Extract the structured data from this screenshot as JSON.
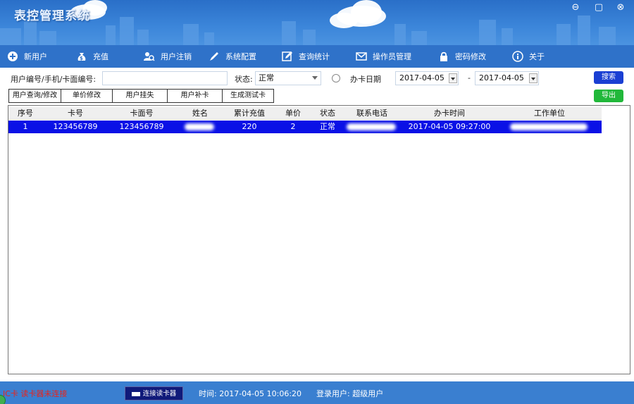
{
  "app": {
    "title": "表控管理系统"
  },
  "window_controls": {
    "minimize": "⊖",
    "maximize": "▢",
    "close": "⊗"
  },
  "toolbar": {
    "items": [
      {
        "label": "新用户",
        "icon": "plus-circle-icon"
      },
      {
        "label": "充值",
        "icon": "money-bag-icon"
      },
      {
        "label": "用户注销",
        "icon": "user-search-icon"
      },
      {
        "label": "系统配置",
        "icon": "pen-icon"
      },
      {
        "label": "查询统计",
        "icon": "edit-report-icon"
      },
      {
        "label": "操作员管理",
        "icon": "envelope-icon"
      },
      {
        "label": "密码修改",
        "icon": "lock-icon"
      },
      {
        "label": "关于",
        "icon": "info-icon"
      }
    ]
  },
  "filter": {
    "user_label": "用户编号/手机/卡面编号:",
    "user_value": "",
    "status_label": "状态:",
    "status_value": "正常",
    "date_label": "办卡日期",
    "date_from": "2017-04-05",
    "date_sep": "-",
    "date_to": "2017-04-05",
    "search_label": "搜索",
    "export_label": "导出"
  },
  "actions": [
    {
      "label": "用户查询/修改"
    },
    {
      "label": "单价修改"
    },
    {
      "label": "用户挂失"
    },
    {
      "label": "用户补卡"
    },
    {
      "label": "生成测试卡"
    }
  ],
  "table": {
    "columns": [
      "序号",
      "卡号",
      "卡面号",
      "姓名",
      "累计充值",
      "单价",
      "状态",
      "联系电话",
      "办卡时间",
      "工作单位"
    ],
    "rows": [
      {
        "index": "1",
        "card_no": "123456789",
        "card_face_no": "123456789",
        "name": "",
        "total_recharge": "220",
        "unit_price": "2",
        "status": "正常",
        "phone": "",
        "issue_time": "2017-04-05 09:27:00",
        "work_unit": ""
      }
    ]
  },
  "status": {
    "reader_status": "IC卡 读卡器未连接",
    "connect_label": "连接读卡器",
    "time_label": "时间: 2017-04-05 10:06:20",
    "login_label": "登录用户: 超级用户"
  },
  "colors": {
    "accent": "#3a7fd0",
    "selected_row": "#0a11e6",
    "search": "#1a3fd3",
    "export": "#21b83a",
    "error_text": "#e8241c"
  }
}
